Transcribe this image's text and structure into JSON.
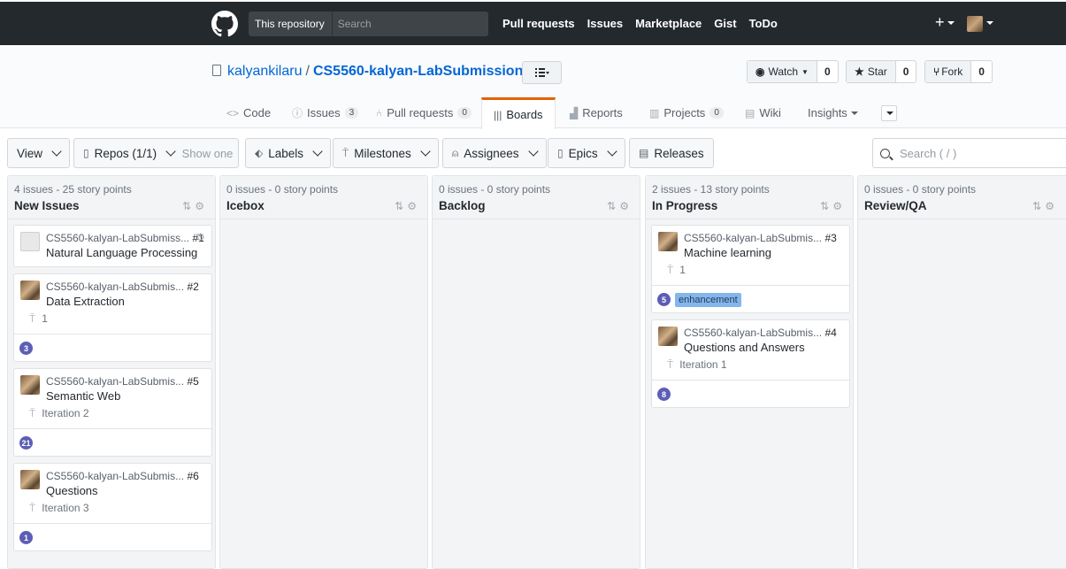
{
  "header": {
    "scope_label": "This repository",
    "search_placeholder": "Search",
    "nav": [
      "Pull requests",
      "Issues",
      "Marketplace",
      "Gist",
      "ToDo"
    ],
    "plus": "+"
  },
  "repo": {
    "owner": "kalyankilaru",
    "separator": "/",
    "name": "CS5560-kalyan-LabSubmission",
    "watch_label": "Watch",
    "watch_count": "0",
    "star_label": "Star",
    "star_count": "0",
    "fork_label": "Fork",
    "fork_count": "0"
  },
  "tabs": {
    "code": "Code",
    "issues": "Issues",
    "issues_count": "3",
    "pulls": "Pull requests",
    "pulls_count": "0",
    "boards": "Boards",
    "reports": "Reports",
    "projects": "Projects",
    "projects_count": "0",
    "wiki": "Wiki",
    "insights": "Insights"
  },
  "toolbar": {
    "view": "View",
    "repos": "Repos (1/1)",
    "show_one": "Show one",
    "labels": "Labels",
    "milestones": "Milestones",
    "assignees": "Assignees",
    "epics": "Epics",
    "releases": "Releases",
    "search_placeholder": "Search ( / )"
  },
  "pipelines": [
    {
      "meta": "4 issues - 25 story points",
      "name": "New Issues",
      "cards": [
        {
          "repo": "CS5560-kalyan-LabSubmiss...",
          "num": "#1",
          "title": "Natural Language Processing"
        },
        {
          "repo": "CS5560-kalyan-LabSubmis...",
          "num": "#2",
          "title": "Data Extraction",
          "milestone": "1",
          "estimate": "3"
        },
        {
          "repo": "CS5560-kalyan-LabSubmis...",
          "num": "#5",
          "title": "Semantic Web",
          "milestone": "Iteration 2",
          "estimate": "21"
        },
        {
          "repo": "CS5560-kalyan-LabSubmis...",
          "num": "#6",
          "title": "Questions",
          "milestone": "Iteration 3",
          "estimate": "1"
        }
      ]
    },
    {
      "meta": "0 issues - 0 story points",
      "name": "Icebox"
    },
    {
      "meta": "0 issues - 0 story points",
      "name": "Backlog"
    },
    {
      "meta": "2 issues - 13 story points",
      "name": "In Progress",
      "cards": [
        {
          "repo": "CS5560-kalyan-LabSubmis...",
          "num": "#3",
          "title": "Machine learning",
          "milestone": "1",
          "estimate": "5",
          "label": "enhancement"
        },
        {
          "repo": "CS5560-kalyan-LabSubmis...",
          "num": "#4",
          "title": "Questions and Answers",
          "milestone": "Iteration 1",
          "estimate": "8"
        }
      ]
    },
    {
      "meta": "0 issues - 0 story points",
      "name": "Review/QA"
    }
  ],
  "colors": {
    "header_bg": "#24292e",
    "link": "#0366d6",
    "active_tab_accent": "#e36209",
    "estimate_badge": "#5c5eb5",
    "enhancement_label": "#84b6eb"
  }
}
